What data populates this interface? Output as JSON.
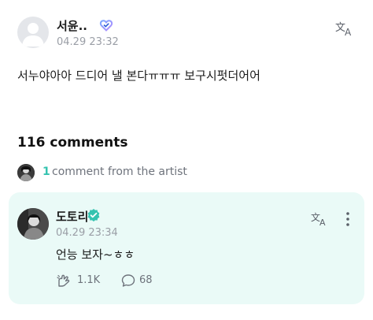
{
  "post": {
    "author_name": "서윤..",
    "timestamp": "04.29 23:32",
    "body": "서누야아아 드디어 낼 본다ㅠㅠㅠ 보구시펏더어어",
    "translate_icon": "translate-icon",
    "badge_icon": "heart-badge-icon"
  },
  "comments": {
    "count_label": "116 comments",
    "artist_count": "1",
    "artist_label": "comment from the artist"
  },
  "artist_comment": {
    "name": "도토리",
    "verified_icon": "verified-check-icon",
    "timestamp": "04.29 23:34",
    "text": "언능 보자~ㅎㅎ",
    "likes": "1.1K",
    "replies": "68"
  },
  "colors": {
    "accent": "#35c3b0",
    "artist_bg": "#eafaf7",
    "muted_text": "#9a9ea6"
  }
}
